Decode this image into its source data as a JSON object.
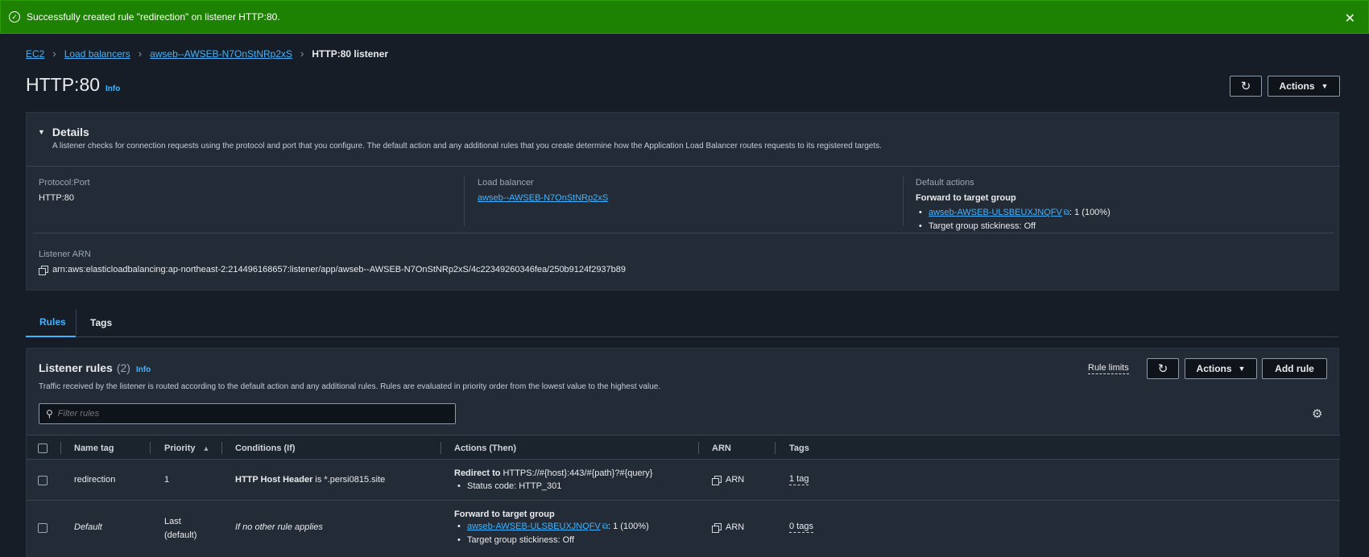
{
  "flash": {
    "message": "Successfully created rule \"redirection\" on listener HTTP:80.",
    "close": "✕"
  },
  "breadcrumb": {
    "items": [
      "EC2",
      "Load balancers",
      "awseb--AWSEB-N7OnStNRp2xS"
    ],
    "current": "HTTP:80 listener"
  },
  "page": {
    "title": "HTTP:80",
    "info": "Info",
    "actions_label": "Actions"
  },
  "details": {
    "heading": "Details",
    "description": "A listener checks for connection requests using the protocol and port that you configure. The default action and any additional rules that you create determine how the Application Load Balancer routes requests to its registered targets.",
    "protocol_port_label": "Protocol:Port",
    "protocol_port_value": "HTTP:80",
    "load_balancer_label": "Load balancer",
    "load_balancer_value": "awseb--AWSEB-N7OnStNRp2xS",
    "default_actions_label": "Default actions",
    "default_actions_title": "Forward to target group",
    "target_group_link": "awseb-AWSEB-ULSBEUXJNQFV",
    "target_group_weight": ": 1 (100%)",
    "stickiness": "Target group stickiness: Off",
    "arn_label": "Listener ARN",
    "arn_value": "arn:aws:elasticloadbalancing:ap-northeast-2:214496168657:listener/app/awseb--AWSEB-N7OnStNRp2xS/4c22349260346fea/250b9124f2937b89"
  },
  "tabs": [
    {
      "label": "Rules",
      "active": true
    },
    {
      "label": "Tags",
      "active": false
    }
  ],
  "rules": {
    "title": "Listener rules",
    "count": "(2)",
    "info": "Info",
    "description": "Traffic received by the listener is routed according to the default action and any additional rules. Rules are evaluated in priority order from the lowest value to the highest value.",
    "rule_limits": "Rule limits",
    "actions_label": "Actions",
    "add_rule": "Add rule",
    "filter_placeholder": "Filter rules",
    "columns": [
      "Name tag",
      "Priority",
      "Conditions (If)",
      "Actions (Then)",
      "ARN",
      "Tags"
    ],
    "rows": [
      {
        "name": "redirection",
        "priority": "1",
        "condition_bold": "HTTP Host Header",
        "condition_rest": " is *.persi0815.site",
        "action_title": "Redirect to",
        "action_target": " HTTPS://#{host}:443/#{path}?#{query}",
        "action_detail": "Status code: HTTP_301",
        "arn": "ARN",
        "tags": "1 tag"
      },
      {
        "name": "Default",
        "priority_line1": "Last",
        "priority_line2": "(default)",
        "condition": "If no other rule applies",
        "action_title": "Forward to target group",
        "target_group_link": "awseb-AWSEB-ULSBEUXJNQFV",
        "target_group_weight": ": 1 (100%)",
        "stickiness": "Target group stickiness: Off",
        "arn": "ARN",
        "tags": "0 tags"
      }
    ]
  },
  "colors": {
    "flash_green": "#1d8102",
    "link_blue": "#42b4ff",
    "panel": "#232b37",
    "background": "#161d26"
  }
}
